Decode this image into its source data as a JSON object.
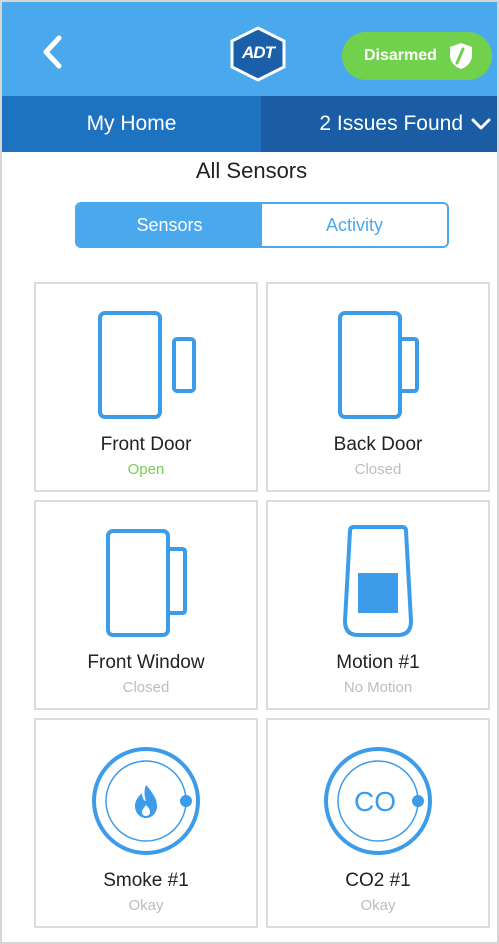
{
  "header": {
    "back_icon": "chevron-left-icon",
    "logo_text": "ADT",
    "status_label": "Disarmed",
    "status_icon": "shield-icon",
    "status_color": "#72d14c",
    "accent": "#4aa8ec"
  },
  "subnav": {
    "home_label": "My Home",
    "issues_label": "2 Issues Found",
    "issues_icon": "chevron-down-icon"
  },
  "page": {
    "title": "All Sensors"
  },
  "tabs": {
    "sensors": "Sensors",
    "activity": "Activity",
    "selected": "Sensors"
  },
  "sensors": [
    {
      "name": "Front Door",
      "state": "Open",
      "icon": "door-sensor-icon"
    },
    {
      "name": "Back Door",
      "state": "Closed",
      "icon": "door-sensor-icon"
    },
    {
      "name": "Front Window",
      "state": "Closed",
      "icon": "window-sensor-icon"
    },
    {
      "name": "Motion #1",
      "state": "No Motion",
      "icon": "motion-sensor-icon"
    },
    {
      "name": "Smoke #1",
      "state": "Okay",
      "icon": "smoke-detector-icon"
    },
    {
      "name": "CO2 #1",
      "state": "Okay",
      "icon": "co-detector-icon",
      "icon_text": "CO"
    }
  ]
}
